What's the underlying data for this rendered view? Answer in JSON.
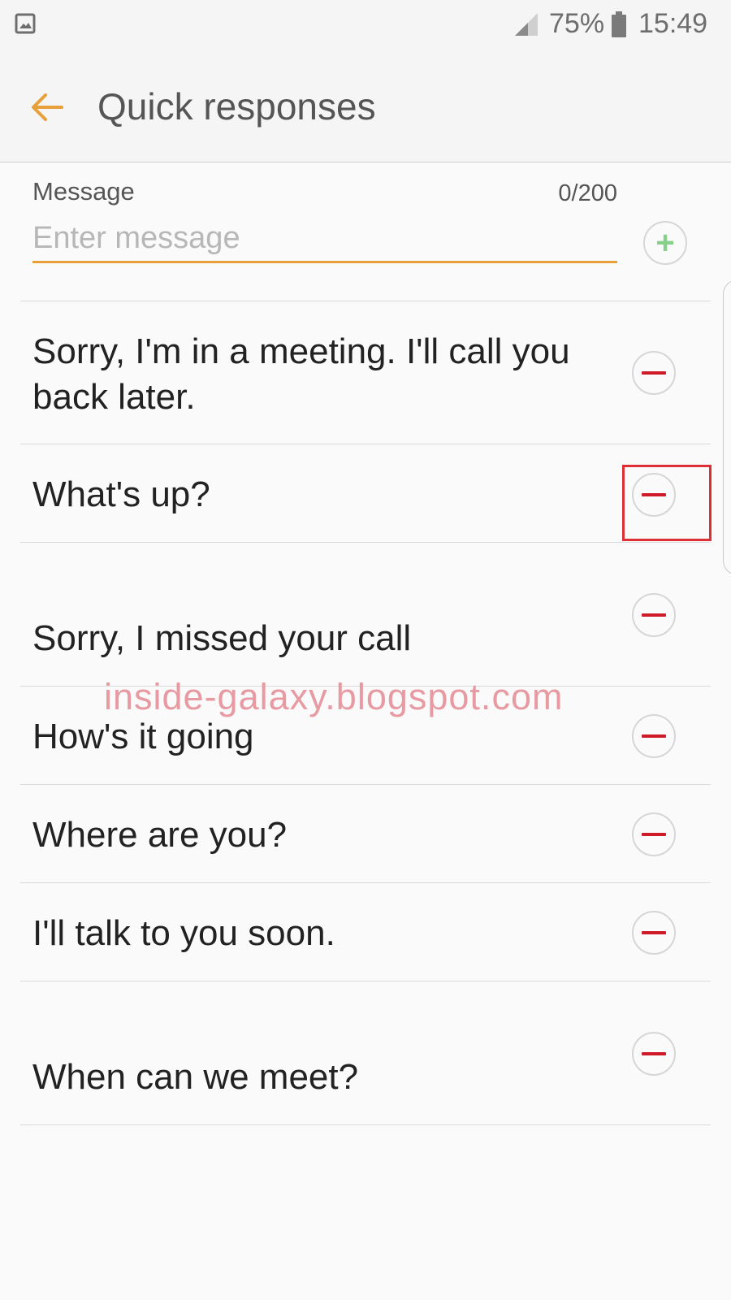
{
  "status_bar": {
    "battery_percent": "75%",
    "time": "15:49",
    "icons": [
      "gallery-icon",
      "signal-icon",
      "battery-icon"
    ]
  },
  "app_bar": {
    "title": "Quick responses",
    "back_icon": "arrow-left-icon"
  },
  "compose": {
    "label": "Message",
    "counter": "0/200",
    "placeholder": "Enter message",
    "value": "",
    "add_icon": "plus-icon"
  },
  "responses": [
    {
      "text": "Sorry, I'm in a meeting. I'll call you back later."
    },
    {
      "text": "What's up?"
    },
    {
      "text": "Sorry, I missed your call"
    },
    {
      "text": "How's it going"
    },
    {
      "text": "Where are you?"
    },
    {
      "text": "I'll talk to you soon."
    },
    {
      "text": "When can we meet?"
    }
  ],
  "watermark": "inside-galaxy.blogspot.com",
  "colors": {
    "accent": "#e7a03a",
    "remove": "#cf1b27",
    "add": "#86d08c",
    "highlight": "#de2f36"
  }
}
